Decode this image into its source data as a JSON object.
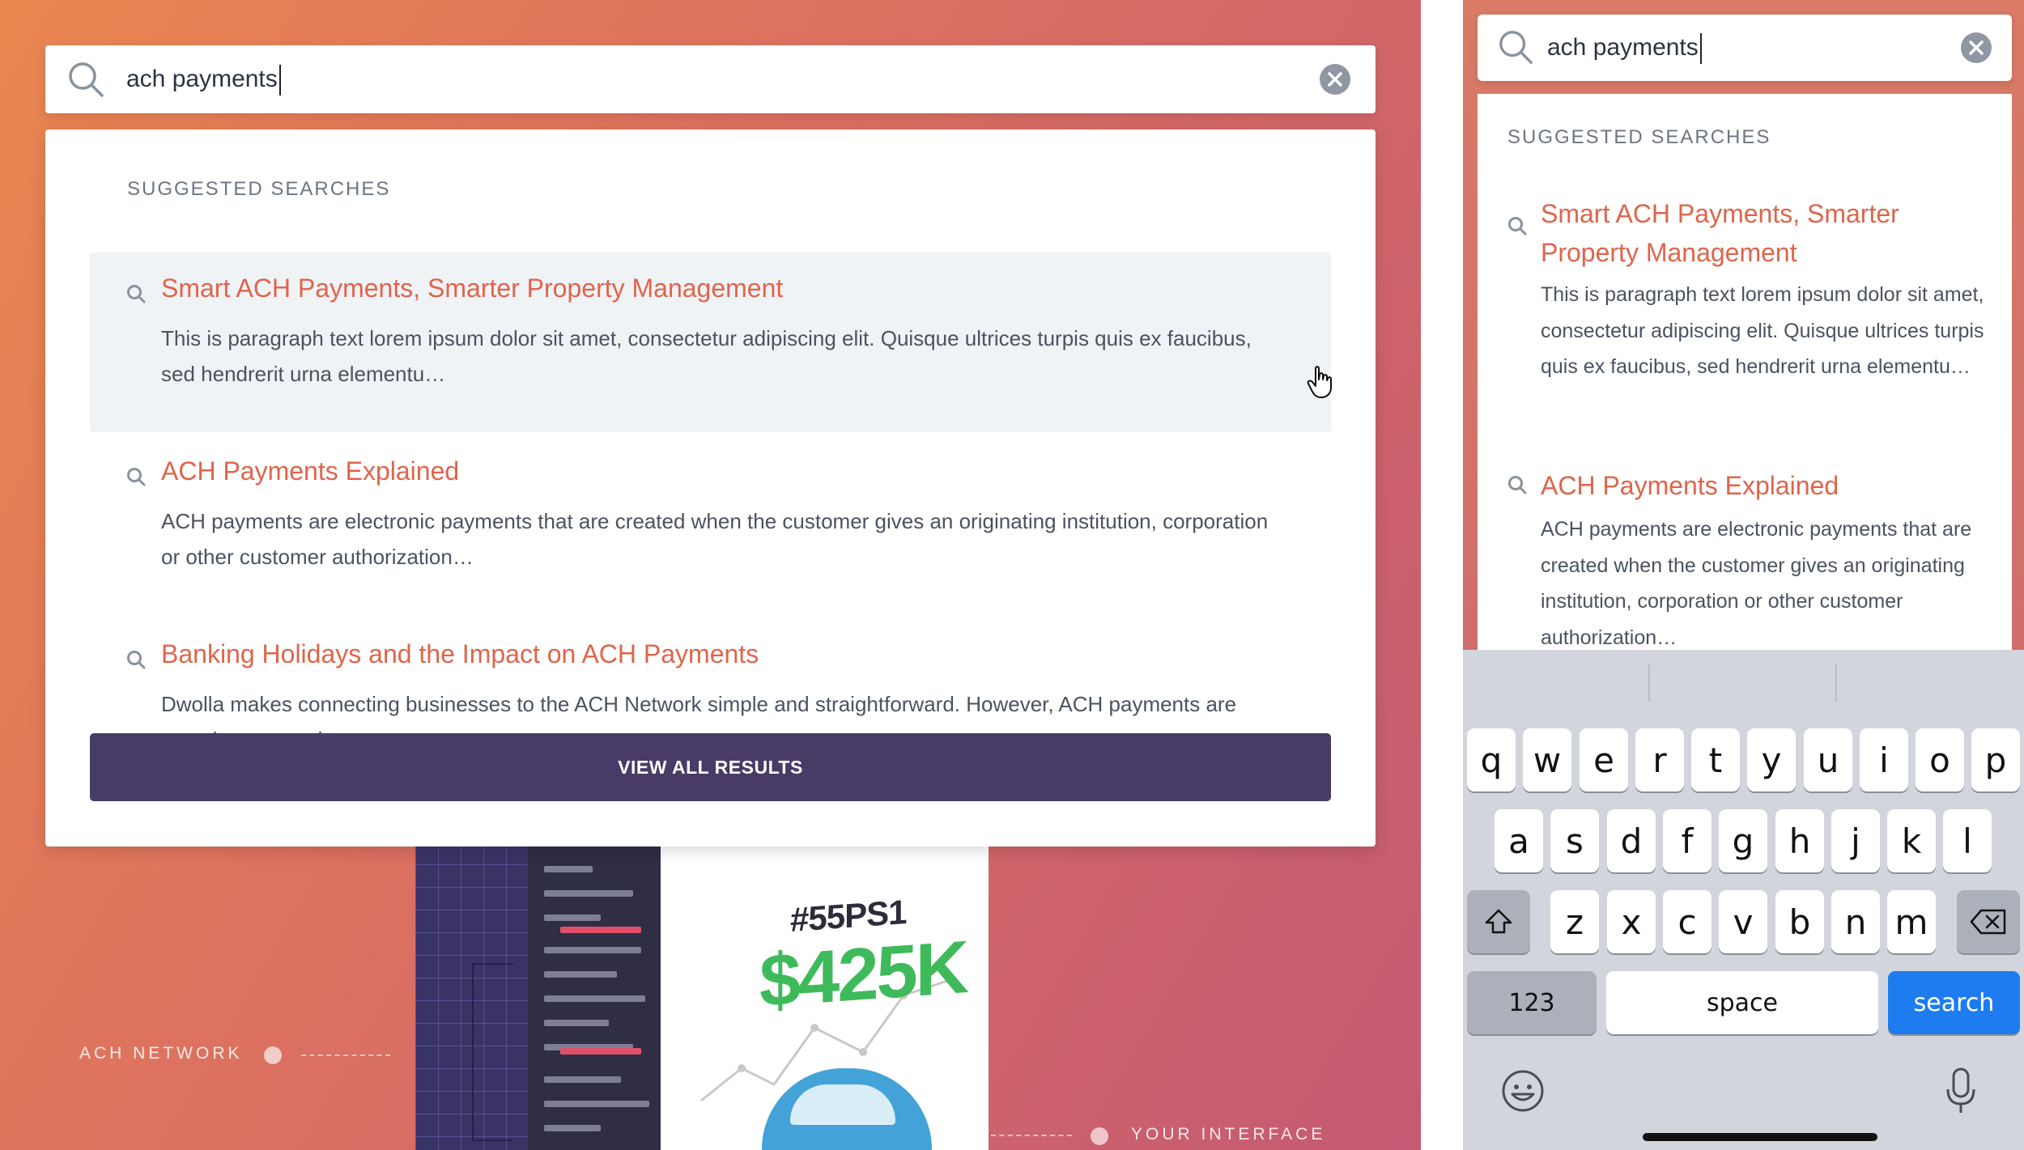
{
  "background": {
    "ach_network_label": "ACH NETWORK",
    "your_interface_label": "YOUR INTERFACE",
    "promo_id": "#55PS1",
    "promo_amount": "$425K"
  },
  "desktop": {
    "search": {
      "query": "ach payments"
    },
    "panel": {
      "section_label": "SUGGESTED SEARCHES",
      "results": [
        {
          "title": "Smart ACH Payments, Smarter Property Management",
          "description": "This is paragraph text lorem ipsum dolor sit amet, consectetur adipiscing elit. Quisque ultrices turpis quis ex faucibus, sed hendrerit urna elementu…",
          "highlighted": true
        },
        {
          "title": "ACH Payments Explained",
          "description": "ACH payments are electronic payments that are created when the customer gives an originating institution, corporation or other customer authorization…",
          "highlighted": false
        },
        {
          "title": "Banking Holidays and the Impact on ACH Payments",
          "description": "Dwolla makes connecting businesses to the ACH Network simple and straightforward. However, ACH payments are complex so we always try to…",
          "highlighted": false
        }
      ],
      "view_all_label": "VIEW ALL RESULTS"
    }
  },
  "mobile": {
    "search": {
      "query": "ach payments"
    },
    "panel": {
      "section_label": "SUGGESTED SEARCHES",
      "results": [
        {
          "title": "Smart ACH Payments, Smarter Property Management",
          "description": "This is paragraph text lorem ipsum dolor sit amet, consectetur adipiscing elit. Quisque ultrices turpis quis ex faucibus, sed hendrerit urna elementu…"
        },
        {
          "title": "ACH Payments Explained",
          "description": "ACH payments are electronic payments that are created when the customer gives an originating institution, corporation or other customer authorization…"
        }
      ]
    },
    "keyboard": {
      "row1": [
        "q",
        "w",
        "e",
        "r",
        "t",
        "y",
        "u",
        "i",
        "o",
        "p"
      ],
      "row2": [
        "a",
        "s",
        "d",
        "f",
        "g",
        "h",
        "j",
        "k",
        "l"
      ],
      "row3": [
        "z",
        "x",
        "c",
        "v",
        "b",
        "n",
        "m"
      ],
      "numbers_label": "123",
      "space_label": "space",
      "search_label": "search"
    }
  },
  "colors": {
    "accent_title": "#e0644a",
    "button_bg": "#483b67",
    "keyboard_action": "#1e7cf0"
  },
  "icons": [
    "search-icon",
    "clear-icon",
    "hand-cursor-icon",
    "shift-icon",
    "backspace-icon",
    "emoji-icon",
    "microphone-icon"
  ]
}
